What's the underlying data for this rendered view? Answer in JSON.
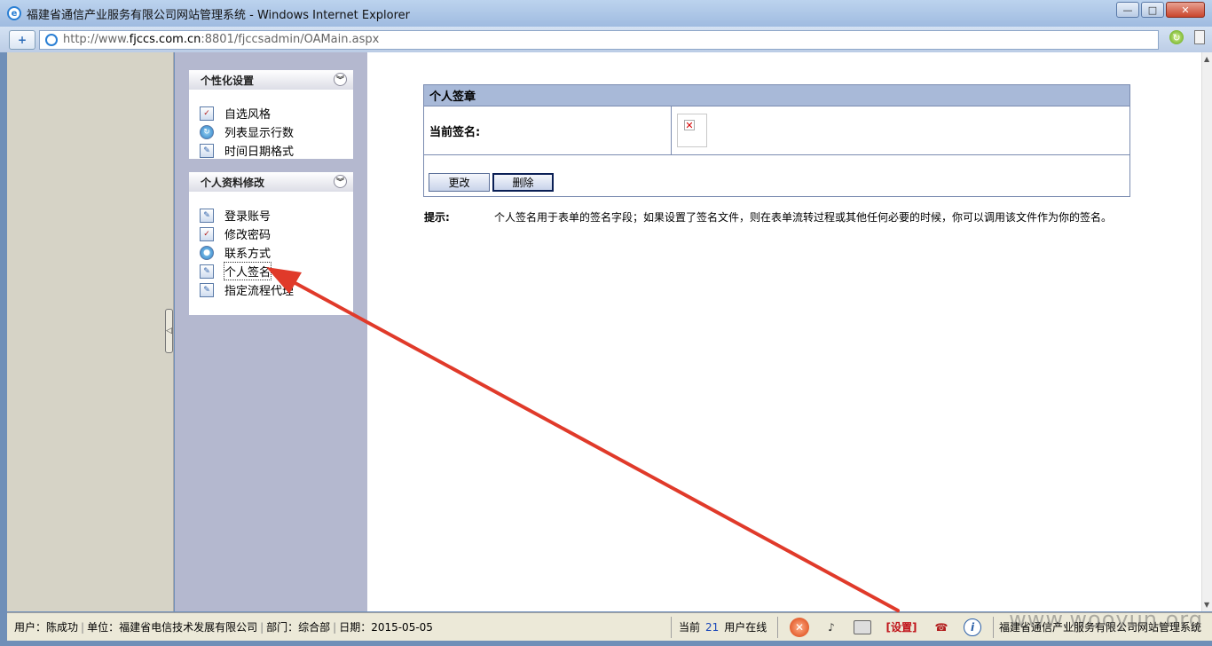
{
  "window": {
    "title": "福建省通信产业服务有限公司网站管理系统 - Windows Internet Explorer",
    "controls": [
      "—",
      "□",
      "✕"
    ]
  },
  "address": {
    "prefix": "http://www.",
    "host": "fjccs.com.cn",
    "suffix": ":8801/fjccsadmin/OAMain.aspx"
  },
  "sidebar": {
    "panels": [
      {
        "title": "个性化设置",
        "items": [
          {
            "label": "自选风格",
            "icon": "checklist-icon"
          },
          {
            "label": "列表显示行数",
            "icon": "list-count-icon"
          },
          {
            "label": "时间日期格式",
            "icon": "edit-icon"
          }
        ]
      },
      {
        "title": "个人资料修改",
        "items": [
          {
            "label": "登录账号",
            "icon": "edit-icon"
          },
          {
            "label": "修改密码",
            "icon": "checklist-icon"
          },
          {
            "label": "联系方式",
            "icon": "globe-icon"
          },
          {
            "label": "个人签名",
            "icon": "edit-icon"
          },
          {
            "label": "指定流程代理",
            "icon": "edit-icon"
          }
        ]
      }
    ]
  },
  "signature": {
    "header": "个人签章",
    "current_label": "当前签名:",
    "change_label": "更改",
    "delete_label": "删除",
    "hint_label": "提示:",
    "hint_text": "个人签名用于表单的签名字段；如果设置了签名文件，则在表单流转过程或其他任何必要的时候，你可以调用该文件作为你的签名。"
  },
  "status": {
    "user": "用户：陈成功",
    "unit": "单位：福建省电信技术发展有限公司",
    "dept": "部门：综合部",
    "date": "日期：2015-05-05",
    "online_prefix": "当前",
    "online_count": "21",
    "online_suffix": "用户在线",
    "settings_label": "[设置]",
    "company": "福建省通信产业服务有限公司网站管理系统"
  },
  "watermark": "www.wooyun.org"
}
